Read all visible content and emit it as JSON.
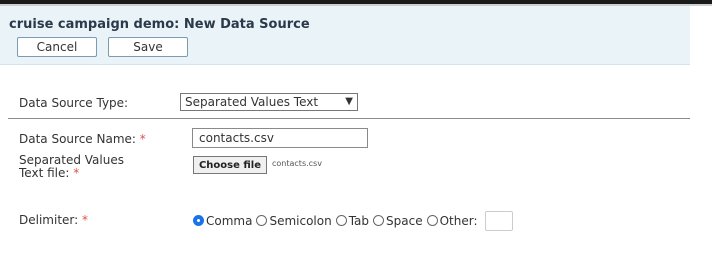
{
  "header": {
    "title": "cruise campaign demo: New Data Source",
    "cancel_label": "Cancel",
    "save_label": "Save"
  },
  "form": {
    "type_label": "Data Source Type:",
    "type_value": "Separated Values Text",
    "name_label": "Data Source Name:",
    "name_value": "contacts.csv",
    "file_label_line1": "Separated Values",
    "file_label_line2": "Text file:",
    "file_button_label": "Choose file",
    "file_name": "contacts.csv",
    "delimiter_label": "Delimiter:",
    "required_marker": "*",
    "delimiter_options": [
      "Comma",
      "Semicolon",
      "Tab",
      "Space",
      "Other:"
    ],
    "delimiter_selected": "Comma"
  },
  "colors": {
    "header_bg": "#eaf4f8",
    "required": "#d9534f",
    "radio_selected": "#1a73e8"
  }
}
